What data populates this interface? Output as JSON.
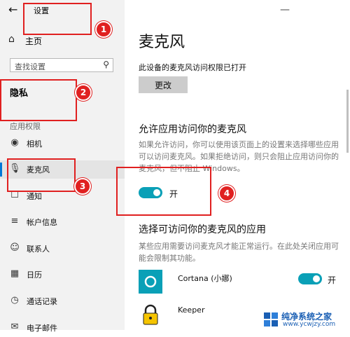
{
  "window": {
    "title": "设置",
    "back_icon": "←",
    "minimize_icon": "—"
  },
  "sidebar": {
    "home_label": "主页",
    "home_icon": "⌂",
    "search": {
      "placeholder": "查找设置",
      "icon": "⚲"
    },
    "privacy_heading": "隐私",
    "section_label": "应用权限",
    "items": [
      {
        "icon": "◉",
        "label": "相机"
      },
      {
        "icon": "🎙",
        "label": "麦克风"
      },
      {
        "icon": "☐",
        "label": "通知"
      },
      {
        "icon": "≡",
        "label": "帐户信息"
      },
      {
        "icon": "☺",
        "label": "联系人"
      },
      {
        "icon": "▦",
        "label": "日历"
      },
      {
        "icon": "◷",
        "label": "通话记录"
      },
      {
        "icon": "✉",
        "label": "电子邮件"
      }
    ]
  },
  "main": {
    "title": "麦克风",
    "status_text": "此设备的麦克风访问权限已打开",
    "change_button": "更改",
    "allow_heading": "允许应用访问你的麦克风",
    "allow_desc": "如果允许访问，你可以使用该页面上的设置来选择哪些应用可以访问麦克风。如果拒绝访问，则只会阻止应用访问你的麦克风，但不阻止 Windows。",
    "allow_toggle": {
      "state": "on",
      "label": "开"
    },
    "choose_heading": "选择可访问你的麦克风的应用",
    "choose_desc": "某些应用需要访问麦克风才能正常运行。在此处关闭应用可能会限制其功能。",
    "apps": [
      {
        "name": "Cortana (小娜)",
        "toggle_label": "开",
        "state": "on"
      },
      {
        "name": "Keeper"
      }
    ]
  },
  "annotations": [
    "1",
    "2",
    "3",
    "4"
  ],
  "watermark": {
    "title": "纯净系统之家",
    "url": "www.ycwjzy.com"
  },
  "colors": {
    "accent": "#0078d7",
    "toggle_on": "#0aa0b7",
    "annotation_red": "#e02020",
    "sidebar_bg": "#f2f2f2"
  }
}
